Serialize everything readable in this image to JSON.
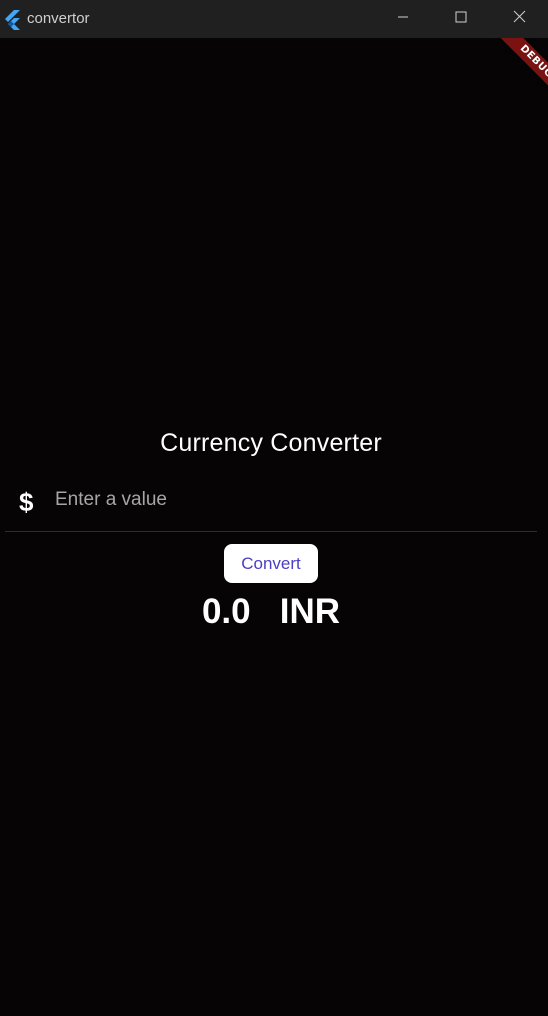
{
  "window": {
    "title": "convertor",
    "controls": {
      "minimize_icon": "minimize-icon",
      "maximize_icon": "maximize-icon",
      "close_icon": "close-icon"
    },
    "debug_banner": "DEBUG"
  },
  "app": {
    "heading": "Currency Converter",
    "input": {
      "prefix_icon": "dollar-icon",
      "prefix_symbol": "$",
      "placeholder": "Enter a value",
      "value": ""
    },
    "convert_button": {
      "label": "Convert"
    },
    "result": {
      "amount": "0.0",
      "currency": "INR"
    }
  },
  "colors": {
    "background": "#060404",
    "titlebar": "#202020",
    "button_bg": "#ffffff",
    "button_text": "#4a3ec2",
    "debug_banner": "#7a1212",
    "flutter_logo": "#42a5f5"
  }
}
